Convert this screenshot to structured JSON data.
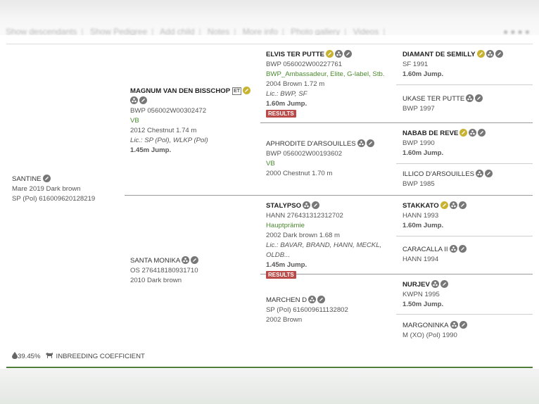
{
  "nav": {
    "items": [
      "Show descendants",
      "Show Pedigree",
      "Add child",
      "Notes",
      "More info",
      "Photo gallery",
      "Videos"
    ],
    "right_icons": [
      "share-icon",
      "facebook-icon",
      "print-icon",
      "more-icon"
    ]
  },
  "subject": {
    "name": "SANTINE",
    "line1": "Mare 2019 Dark brown",
    "line2": "SP (Pol) 616009620128219"
  },
  "sire": {
    "name": "MAGNUM VAN DEN BISSCHOP",
    "badge": "ET",
    "reg": "BWP 056002W00302472",
    "predicate": "VB",
    "desc": "2012 Chestnut 1.74 m",
    "lic": "Lic.: SP (Pol), WLKP (Pol)",
    "jump": "1.45m Jump."
  },
  "dam": {
    "name": "SANTA MONIKA",
    "reg": "OS 276418180931710",
    "desc": "2010 Dark brown"
  },
  "gen3": [
    {
      "name": "ELVIS TER PUTTE",
      "reg": "BWP 056002W00227761",
      "predicate": "BWP_Ambassadeur, Elite, G-label, Stb.",
      "desc": "2004 Brown 1.72 m",
      "lic": "Lic.: BWP, SF",
      "jump": "1.60m Jump.",
      "results": "RESULTS"
    },
    {
      "name": "APHRODITE D'ARSOUILLES",
      "reg": "BWP 056002W00193602",
      "predicate": "VB",
      "desc": "2000 Chestnut 1.70 m"
    },
    {
      "name": "STALYPSO",
      "reg": "HANN 276431312312702",
      "predicate": "Hauptprämie",
      "desc": "2002 Dark brown 1.68 m",
      "lic": "Lic.: BAVAR, BRAND, HANN, MECKL, OLDB...",
      "jump": "1.45m Jump.",
      "results": "RESULTS"
    },
    {
      "name": "MARCHEN D",
      "reg": "SP (Pol) 616009611132802",
      "desc": "2002 Brown"
    }
  ],
  "gen4": [
    {
      "name": "DIAMANT DE SEMILLY",
      "reg": "SF 1991",
      "jump": "1.60m Jump."
    },
    {
      "name": "UKASE TER PUTTE",
      "reg": "BWP 1997"
    },
    {
      "name": "NABAB DE REVE",
      "reg": "BWP 1990",
      "jump": "1.60m Jump."
    },
    {
      "name": "ILLICO D'ARSOUILLES",
      "reg": "BWP 1985"
    },
    {
      "name": "STAKKATO",
      "reg": "HANN 1993",
      "jump": "1.60m Jump."
    },
    {
      "name": "CARACALLA II",
      "reg": "HANN 1994"
    },
    {
      "name": "NURJEV",
      "reg": "KWPN 1995",
      "jump": "1.50m Jump."
    },
    {
      "name": "MARGONINKA",
      "reg": "M (XO) (Pol) 1990"
    }
  ],
  "inbreeding": {
    "value": "39.45%",
    "label": "INBREEDING COEFFICIENT"
  },
  "colors": {
    "accent_green": "#4b8a2f",
    "results_red": "#b94a48",
    "gold_icon": "#c8b330",
    "gray_icon": "#777777",
    "bottom_border": "#4d7f3a"
  }
}
